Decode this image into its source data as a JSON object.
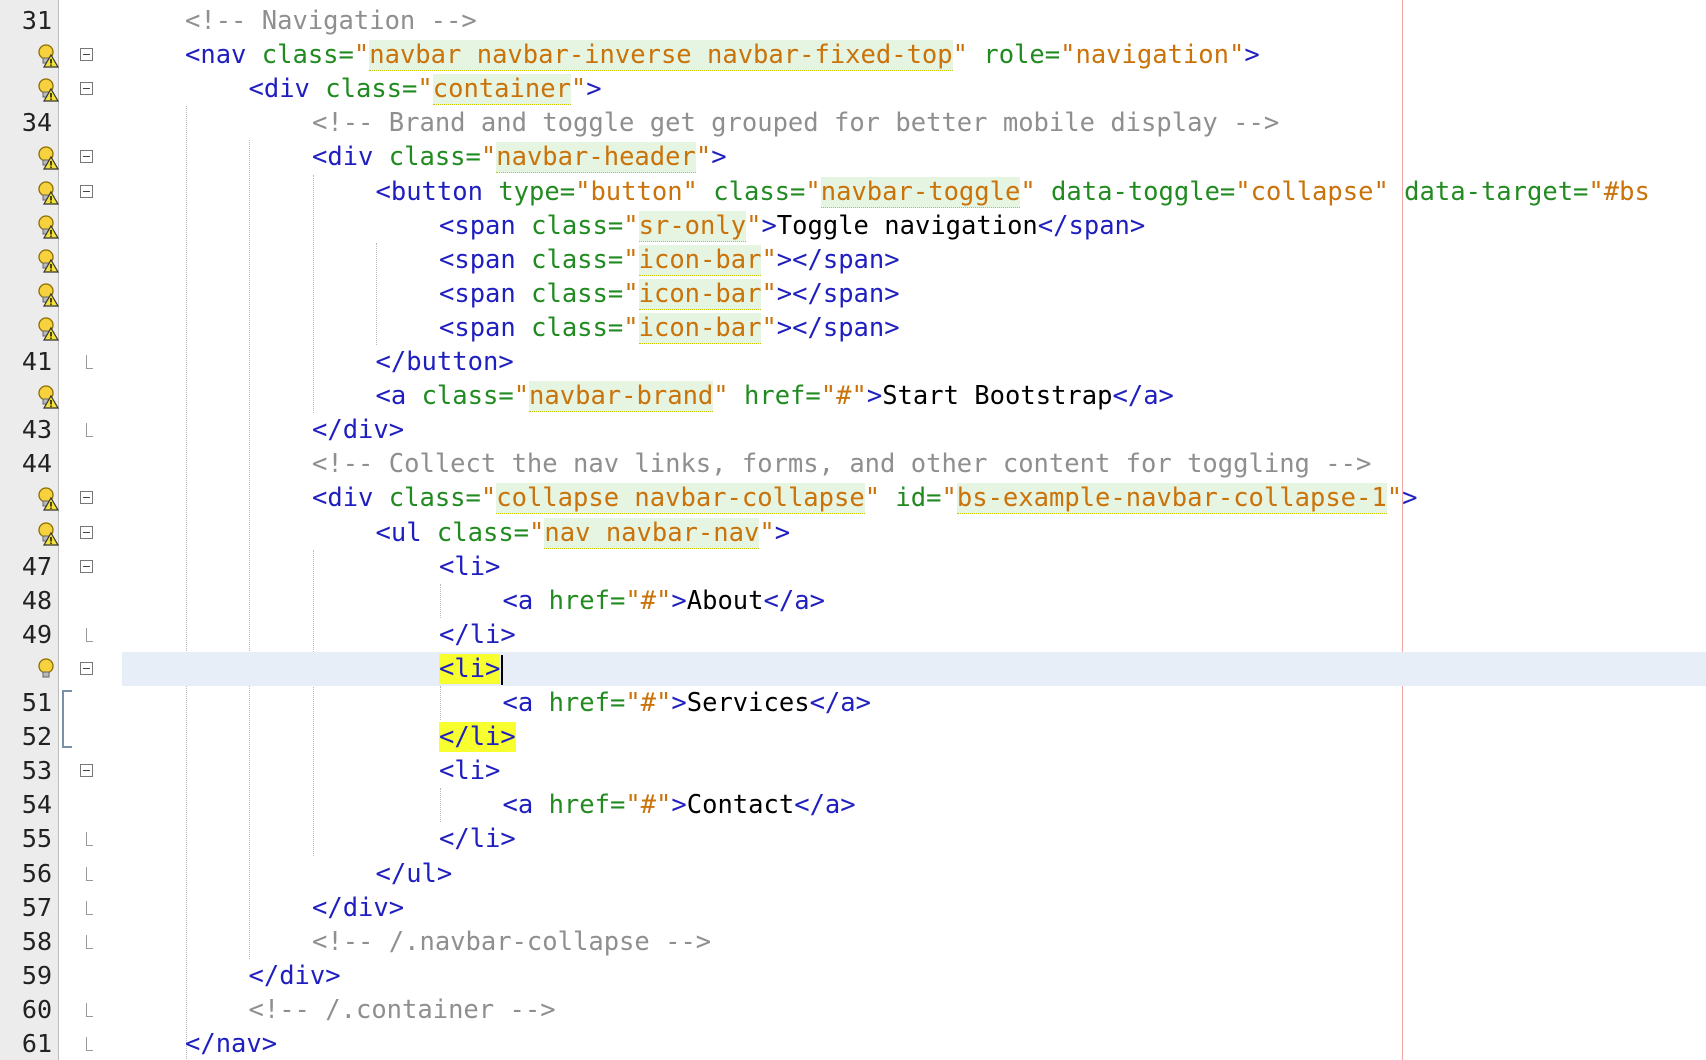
{
  "editor": {
    "line_numbers": [
      "31",
      "34",
      "41",
      "43",
      "44",
      "47",
      "48",
      "49",
      "51",
      "52",
      "53",
      "54",
      "55",
      "56",
      "57",
      "58",
      "59",
      "60",
      "61"
    ],
    "lines": [
      [
        {
          "k": "c",
          "t": "<!-- Navigation -->"
        }
      ],
      [
        {
          "k": "t",
          "t": "<nav "
        },
        {
          "k": "a",
          "t": "class="
        },
        {
          "k": "v",
          "t": "\""
        },
        {
          "k": "hl",
          "t": "navbar navbar-inverse navbar-fixed-top"
        },
        {
          "k": "v",
          "t": "\""
        },
        {
          "k": "a",
          "t": " role="
        },
        {
          "k": "v",
          "t": "\"navigation\""
        },
        {
          "k": "t",
          "t": ">"
        }
      ],
      [
        {
          "k": "t",
          "t": "<div "
        },
        {
          "k": "a",
          "t": "class="
        },
        {
          "k": "v",
          "t": "\""
        },
        {
          "k": "hl",
          "t": "container"
        },
        {
          "k": "v",
          "t": "\""
        },
        {
          "k": "t",
          "t": ">"
        }
      ],
      [
        {
          "k": "c",
          "t": "<!-- Brand and toggle get grouped for better mobile display -->"
        }
      ],
      [
        {
          "k": "t",
          "t": "<div "
        },
        {
          "k": "a",
          "t": "class="
        },
        {
          "k": "v",
          "t": "\""
        },
        {
          "k": "hl",
          "t": "navbar-header"
        },
        {
          "k": "v",
          "t": "\""
        },
        {
          "k": "t",
          "t": ">"
        }
      ],
      [
        {
          "k": "t",
          "t": "<button "
        },
        {
          "k": "a",
          "t": "type="
        },
        {
          "k": "v",
          "t": "\"button\""
        },
        {
          "k": "a",
          "t": " class="
        },
        {
          "k": "v",
          "t": "\""
        },
        {
          "k": "hl",
          "t": "navbar-toggle"
        },
        {
          "k": "v",
          "t": "\""
        },
        {
          "k": "a",
          "t": " data-toggle="
        },
        {
          "k": "v",
          "t": "\"collapse\""
        },
        {
          "k": "a",
          "t": " data-target="
        },
        {
          "k": "v",
          "t": "\"#bs"
        }
      ],
      [
        {
          "k": "t",
          "t": "<span "
        },
        {
          "k": "a",
          "t": "class="
        },
        {
          "k": "v",
          "t": "\""
        },
        {
          "k": "hl",
          "t": "sr-only"
        },
        {
          "k": "v",
          "t": "\""
        },
        {
          "k": "t",
          "t": ">"
        },
        {
          "k": "x",
          "t": "Toggle navigation"
        },
        {
          "k": "t",
          "t": "</span>"
        }
      ],
      [
        {
          "k": "t",
          "t": "<span "
        },
        {
          "k": "a",
          "t": "class="
        },
        {
          "k": "v",
          "t": "\""
        },
        {
          "k": "hl",
          "t": "icon-bar"
        },
        {
          "k": "v",
          "t": "\""
        },
        {
          "k": "t",
          "t": "></span>"
        }
      ],
      [
        {
          "k": "t",
          "t": "<span "
        },
        {
          "k": "a",
          "t": "class="
        },
        {
          "k": "v",
          "t": "\""
        },
        {
          "k": "hl",
          "t": "icon-bar"
        },
        {
          "k": "v",
          "t": "\""
        },
        {
          "k": "t",
          "t": "></span>"
        }
      ],
      [
        {
          "k": "t",
          "t": "<span "
        },
        {
          "k": "a",
          "t": "class="
        },
        {
          "k": "v",
          "t": "\""
        },
        {
          "k": "hl",
          "t": "icon-bar"
        },
        {
          "k": "v",
          "t": "\""
        },
        {
          "k": "t",
          "t": "></span>"
        }
      ],
      [
        {
          "k": "t",
          "t": "</button>"
        }
      ],
      [
        {
          "k": "t",
          "t": "<a "
        },
        {
          "k": "a",
          "t": "class="
        },
        {
          "k": "v",
          "t": "\""
        },
        {
          "k": "hl",
          "t": "navbar-brand"
        },
        {
          "k": "v",
          "t": "\""
        },
        {
          "k": "a",
          "t": " href="
        },
        {
          "k": "v",
          "t": "\"#\""
        },
        {
          "k": "t",
          "t": ">"
        },
        {
          "k": "x",
          "t": "Start Bootstrap"
        },
        {
          "k": "t",
          "t": "</a>"
        }
      ],
      [
        {
          "k": "t",
          "t": "</div>"
        }
      ],
      [
        {
          "k": "c",
          "t": "<!-- Collect the nav links, forms, and other content for toggling -->"
        }
      ],
      [
        {
          "k": "t",
          "t": "<div "
        },
        {
          "k": "a",
          "t": "class="
        },
        {
          "k": "v",
          "t": "\""
        },
        {
          "k": "hl",
          "t": "collapse navbar-collapse"
        },
        {
          "k": "v",
          "t": "\""
        },
        {
          "k": "a",
          "t": " id="
        },
        {
          "k": "v",
          "t": "\""
        },
        {
          "k": "hl",
          "t": "bs-example-navbar-collapse-1"
        },
        {
          "k": "v",
          "t": "\""
        },
        {
          "k": "t",
          "t": ">"
        }
      ],
      [
        {
          "k": "t",
          "t": "<ul "
        },
        {
          "k": "a",
          "t": "class="
        },
        {
          "k": "v",
          "t": "\""
        },
        {
          "k": "hl",
          "t": "nav navbar-nav"
        },
        {
          "k": "v",
          "t": "\""
        },
        {
          "k": "t",
          "t": ">"
        }
      ],
      [
        {
          "k": "t",
          "t": "<li>"
        }
      ],
      [
        {
          "k": "t",
          "t": "<a "
        },
        {
          "k": "a",
          "t": "href="
        },
        {
          "k": "v",
          "t": "\"#\""
        },
        {
          "k": "t",
          "t": ">"
        },
        {
          "k": "x",
          "t": "About"
        },
        {
          "k": "t",
          "t": "</a>"
        }
      ],
      [
        {
          "k": "t",
          "t": "</li>"
        }
      ],
      [
        {
          "k": "match",
          "t": "<li>"
        }
      ],
      [
        {
          "k": "t",
          "t": "<a "
        },
        {
          "k": "a",
          "t": "href="
        },
        {
          "k": "v",
          "t": "\"#\""
        },
        {
          "k": "t",
          "t": ">"
        },
        {
          "k": "x",
          "t": "Services"
        },
        {
          "k": "t",
          "t": "</a>"
        }
      ],
      [
        {
          "k": "match",
          "t": "</li>"
        }
      ],
      [
        {
          "k": "t",
          "t": "<li>"
        }
      ],
      [
        {
          "k": "t",
          "t": "<a "
        },
        {
          "k": "a",
          "t": "href="
        },
        {
          "k": "v",
          "t": "\"#\""
        },
        {
          "k": "t",
          "t": ">"
        },
        {
          "k": "x",
          "t": "Contact"
        },
        {
          "k": "t",
          "t": "</a>"
        }
      ],
      [
        {
          "k": "t",
          "t": "</li>"
        }
      ],
      [
        {
          "k": "t",
          "t": "</ul>"
        }
      ],
      [
        {
          "k": "t",
          "t": "</div>"
        }
      ],
      [
        {
          "k": "c",
          "t": "<!-- /.navbar-collapse -->"
        }
      ],
      [
        {
          "k": "t",
          "t": "</div>"
        }
      ],
      [
        {
          "k": "c",
          "t": "<!-- /.container -->"
        }
      ],
      [
        {
          "k": "t",
          "t": "</nav>"
        }
      ]
    ]
  }
}
